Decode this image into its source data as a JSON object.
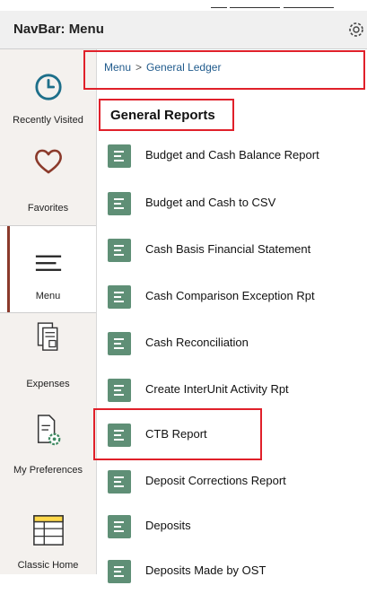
{
  "navbar": {
    "title": "NavBar: Menu",
    "settings_icon": "gear-icon"
  },
  "sidebar": {
    "items": [
      {
        "label": "Recently Visited",
        "icon": "clock-icon"
      },
      {
        "label": "Favorites",
        "icon": "heart-icon"
      },
      {
        "label": "Menu",
        "icon": "menu-lines-icon",
        "active": true
      },
      {
        "label": "Expenses",
        "icon": "expenses-icon"
      },
      {
        "label": "My Preferences",
        "icon": "preferences-icon"
      },
      {
        "label": "Classic Home",
        "icon": "classic-home-icon"
      }
    ]
  },
  "breadcrumb": {
    "root": "Menu",
    "separator": ">",
    "current": "General Ledger"
  },
  "section": {
    "title": "General Reports"
  },
  "reports": [
    "Budget and Cash Balance Report",
    "Budget and Cash to CSV",
    "Cash Basis Financial Statement",
    "Cash Comparison Exception Rpt",
    "Cash Reconciliation",
    "Create InterUnit Activity Rpt",
    "CTB Report",
    "Deposit Corrections Report",
    "Deposits",
    "Deposits Made by OST"
  ],
  "colors": {
    "accent_green": "#5f8f76",
    "highlight_red": "#e0202a",
    "link_blue": "#1f5a8c",
    "active_bar": "#8b3a2b"
  }
}
